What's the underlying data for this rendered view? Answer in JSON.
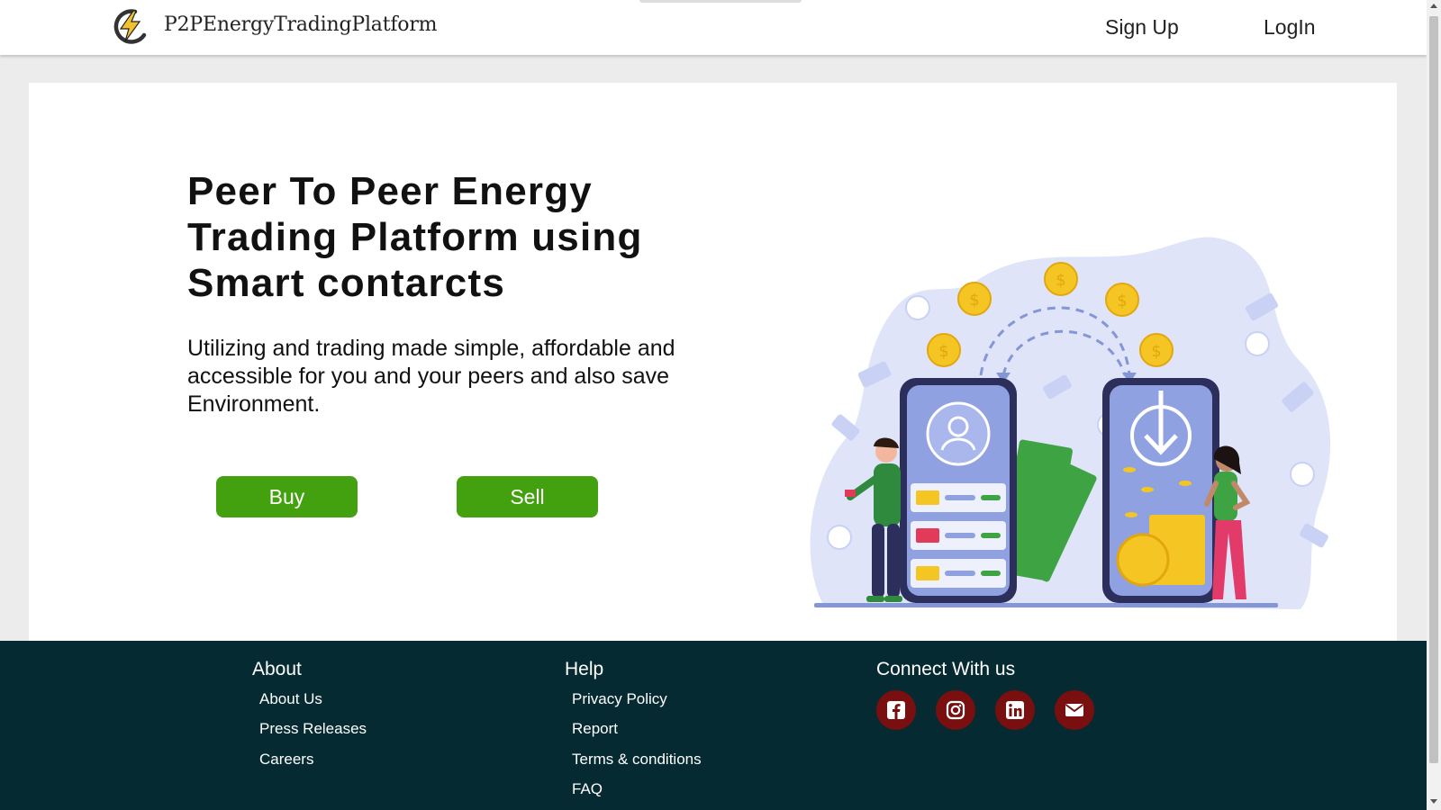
{
  "header": {
    "brand": "P2PEnergyTradingPlatform",
    "nav": {
      "signup": "Sign Up",
      "login": "LogIn"
    }
  },
  "hero": {
    "title": "Peer To Peer Energy Trading Platform using Smart contarcts",
    "subtitle": "Utilizing and trading made simple, affordable and accessible for you and your peers and also save Environment.",
    "buy_label": "Buy",
    "sell_label": "Sell"
  },
  "footer": {
    "about": {
      "heading": "About",
      "links": [
        "About Us",
        "Press Releases",
        "Careers"
      ]
    },
    "help": {
      "heading": "Help",
      "links": [
        "Privacy Policy",
        "Report",
        "Terms & conditions",
        "FAQ"
      ]
    },
    "connect": {
      "heading": "Connect With us",
      "icons": [
        "facebook-icon",
        "instagram-icon",
        "linkedin-icon",
        "email-icon"
      ]
    }
  },
  "colors": {
    "accent_green": "#43a00f",
    "footer_bg": "#062a31",
    "social_bg": "#7a0f0f",
    "logo_yellow": "#f2c12e"
  }
}
